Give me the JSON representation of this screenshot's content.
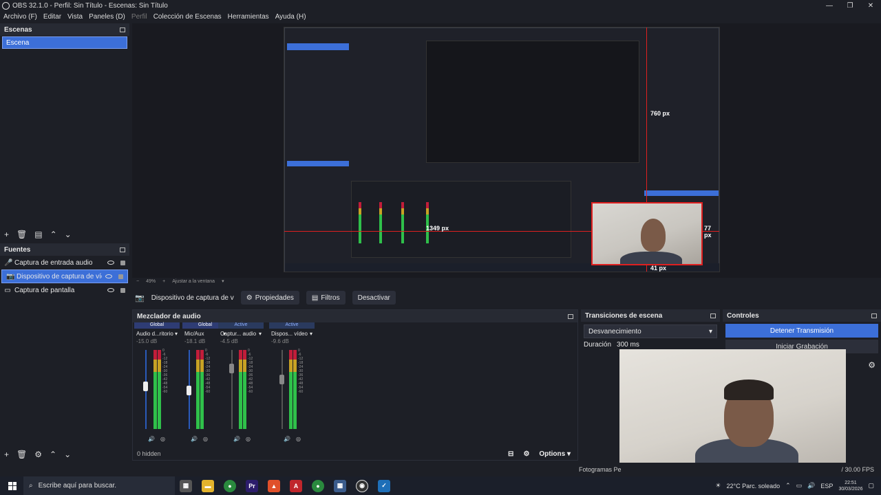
{
  "window": {
    "title": "OBS 32.1.0 - Perfil: Sin Título - Escenas: Sin Título",
    "controls": [
      "—",
      "❐",
      "✕"
    ]
  },
  "menu": [
    "Archivo (F)",
    "Editar",
    "Vista",
    "Paneles (D)",
    "Perfil",
    "Colección de Escenas",
    "Herramientas",
    "Ayuda (H)"
  ],
  "scenes": {
    "title": "Escenas",
    "items": [
      "Escena"
    ]
  },
  "sources": {
    "title": "Fuentes",
    "items": [
      {
        "label": "Captura de entrada audio",
        "icon": "microphone-icon"
      },
      {
        "label": "Dispositivo de captura de vídeo",
        "icon": "camera-icon"
      },
      {
        "label": "Captura de pantalla",
        "icon": "monitor-icon"
      }
    ]
  },
  "preview": {
    "measure_top": "760 px",
    "measure_left": "1349 px",
    "measure_right": "77 px",
    "measure_bottom": "41 px",
    "zoom": "49%",
    "fit": "Ajustar a la ventana"
  },
  "context_bar": {
    "source_label": "Dispositivo de captura de v",
    "properties": "Propiedades",
    "filters": "Filtros",
    "deactivate": "Desactivar"
  },
  "mixer": {
    "title": "Mezclador de audio",
    "strips": [
      {
        "badge": "Global",
        "name": "Audio d...ritorio",
        "db": "-15.0 dB",
        "level": 0.58
      },
      {
        "badge": "Global",
        "name": "Mic/Aux",
        "db": "-18.1 dB",
        "level": 0.52
      },
      {
        "badge": "Active",
        "name": "Captur... audio",
        "db": "-4.5 dB",
        "level": 0.82
      },
      {
        "badge": "Active",
        "name": "Dispos... vídeo",
        "db": "-9.6 dB",
        "level": 0.69
      }
    ],
    "scale": [
      "0",
      "-6",
      "-12",
      "-18",
      "-24",
      "-30",
      "-36",
      "-42",
      "-48",
      "-54",
      "-60"
    ],
    "hidden": "0 hidden",
    "options": "Options"
  },
  "transitions": {
    "title": "Transiciones de escena",
    "selected": "Desvanecimiento",
    "duration_label": "Duración",
    "duration_value": "300 ms"
  },
  "controls": {
    "title": "Controles",
    "stop_stream": "Detener Transmisión",
    "start_record": "Iniciar Grabación"
  },
  "status": {
    "fps_label": "Fotogramas Pe",
    "fps": "/ 30.00 FPS"
  },
  "taskbar": {
    "search_placeholder": "Escribe aquí para buscar.",
    "weather": "22°C  Parc. soleado",
    "lang": "ESP",
    "time": "22:51",
    "date": "30/03/2026"
  }
}
